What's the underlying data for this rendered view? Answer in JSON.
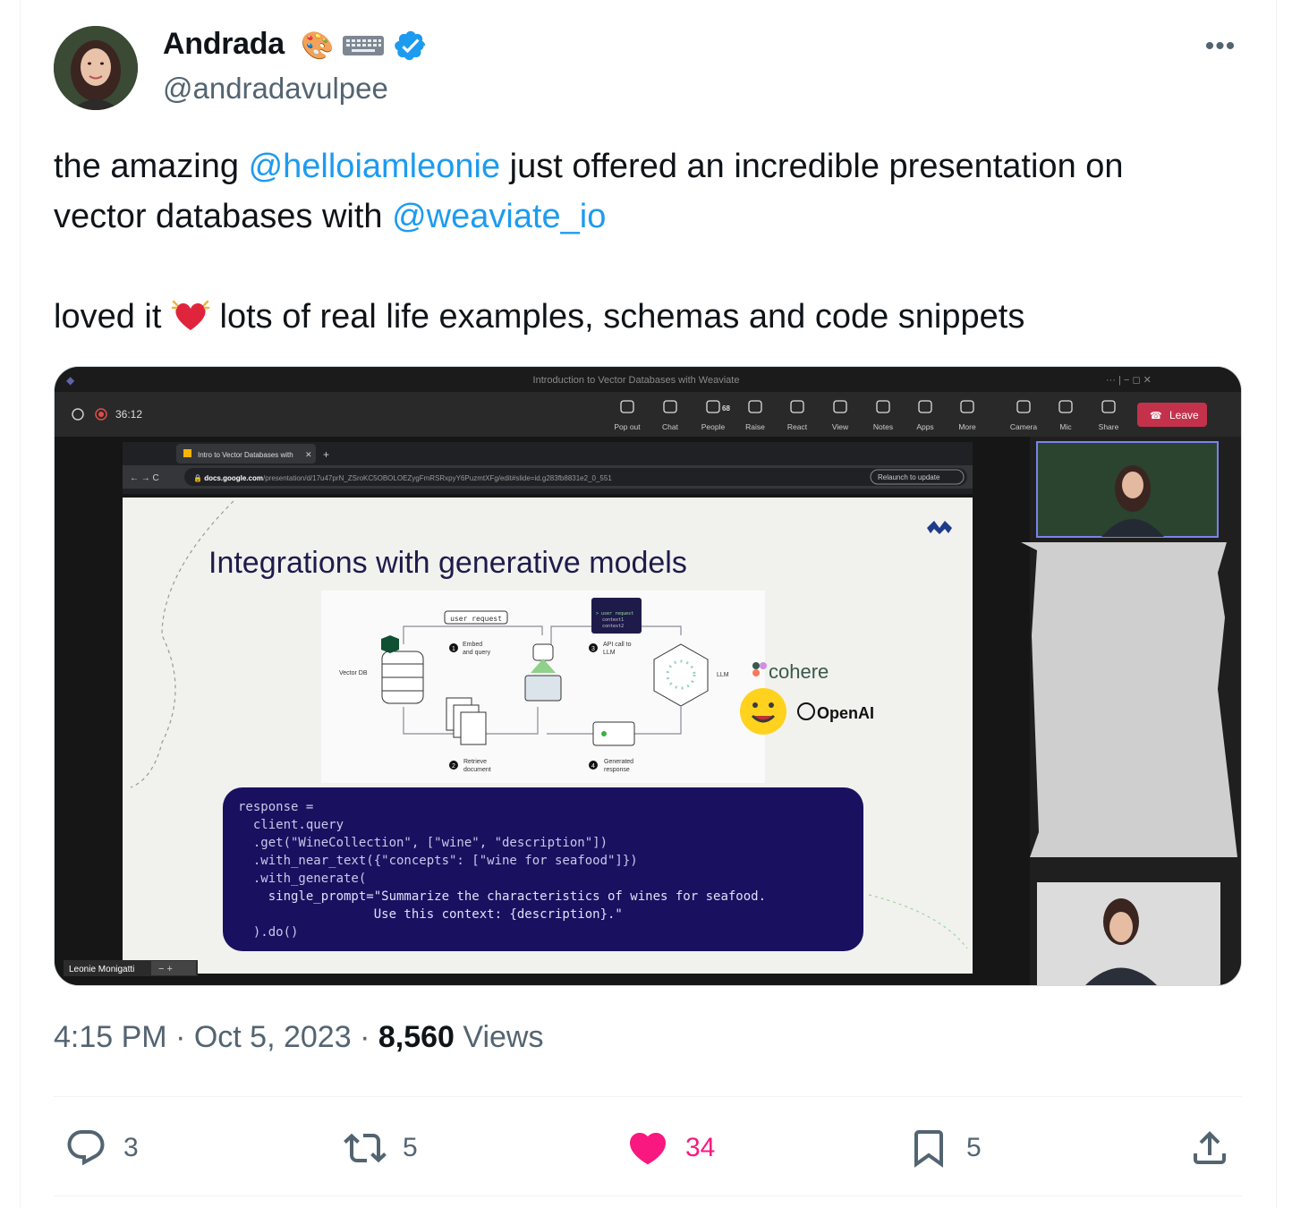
{
  "author": {
    "name": "Andrada",
    "emojis": [
      "🎨",
      "⌨️"
    ],
    "handle": "@andradavulpee",
    "verified_icon": "verified-badge-icon"
  },
  "tweet": {
    "line1_pre": "the amazing ",
    "mention1": "@helloiamleonie",
    "line1_post": " just offered an incredible presentation on",
    "line2_pre": "vector databases with ",
    "mention2": "@weaviate_io",
    "line3_pre": "loved it ",
    "line3_post": " lots of real life examples, schemas and code snippets"
  },
  "screenshot": {
    "window_title": "Introduction to Vector Databases with Weaviate",
    "timer": "36:12",
    "toolbar": [
      {
        "label": "Pop out",
        "icon": "pop-out-icon"
      },
      {
        "label": "Chat",
        "icon": "chat-icon"
      },
      {
        "label": "People",
        "icon": "people-icon",
        "badge": "68"
      },
      {
        "label": "Raise",
        "icon": "raise-hand-icon"
      },
      {
        "label": "React",
        "icon": "react-icon"
      },
      {
        "label": "View",
        "icon": "view-icon"
      },
      {
        "label": "Notes",
        "icon": "notes-icon"
      },
      {
        "label": "Apps",
        "icon": "apps-icon"
      },
      {
        "label": "More",
        "icon": "more-icon"
      },
      {
        "label": "Camera",
        "icon": "camera-icon"
      },
      {
        "label": "Mic",
        "icon": "mic-off-icon"
      },
      {
        "label": "Share",
        "icon": "share-icon"
      }
    ],
    "leave": "Leave",
    "browser_tab": "Intro to Vector Databases with",
    "url_domain": "docs.google.com",
    "url_path": "/presentation/d/17u47prN_ZSroKC5OBOLOEZygFmRSRxpyY6PuzmtXFg/edit#slide=id.g283fb8831e2_0_551",
    "relaunch": "Relaunch to update",
    "slide_title": "Integrations with generative models",
    "diagram": {
      "user_request": "user request",
      "step1": "Embed\nand query",
      "step2": "Retrieve\ndocument",
      "step3": "API call to\nLLM",
      "step4": "Generated\nresponse",
      "vectordb": "Vector DB",
      "llm": "LLM",
      "prompt_card": [
        "> user request",
        "context1",
        "context2"
      ],
      "context_cards": [
        "context1",
        "context2"
      ],
      "cohere": "cohere",
      "openai": "OpenAI"
    },
    "code": [
      "response =",
      "  client.query",
      "  .get(\"WineCollection\", [\"wine\", \"description\"])",
      "  .with_near_text({\"concepts\": [\"wine for seafood\"]})",
      "  .with_generate(",
      "    single_prompt=\"Summarize the characteristics of wines for seafood.",
      "                  Use this context: {description}.\"",
      "  ).do()"
    ],
    "presenter_name": "Leonie Monigatti"
  },
  "meta": {
    "time": "4:15 PM",
    "sep1": " · ",
    "date": "Oct 5, 2023",
    "sep2": " · ",
    "views_count": "8,560",
    "views_label": " Views"
  },
  "actions": {
    "replies": "3",
    "retweets": "5",
    "likes": "34",
    "bookmarks": "5"
  },
  "colors": {
    "accent": "#1d9bf0",
    "like": "#f91880",
    "teams_leave": "#c4314b",
    "slide_code_bg": "#1a1060"
  }
}
